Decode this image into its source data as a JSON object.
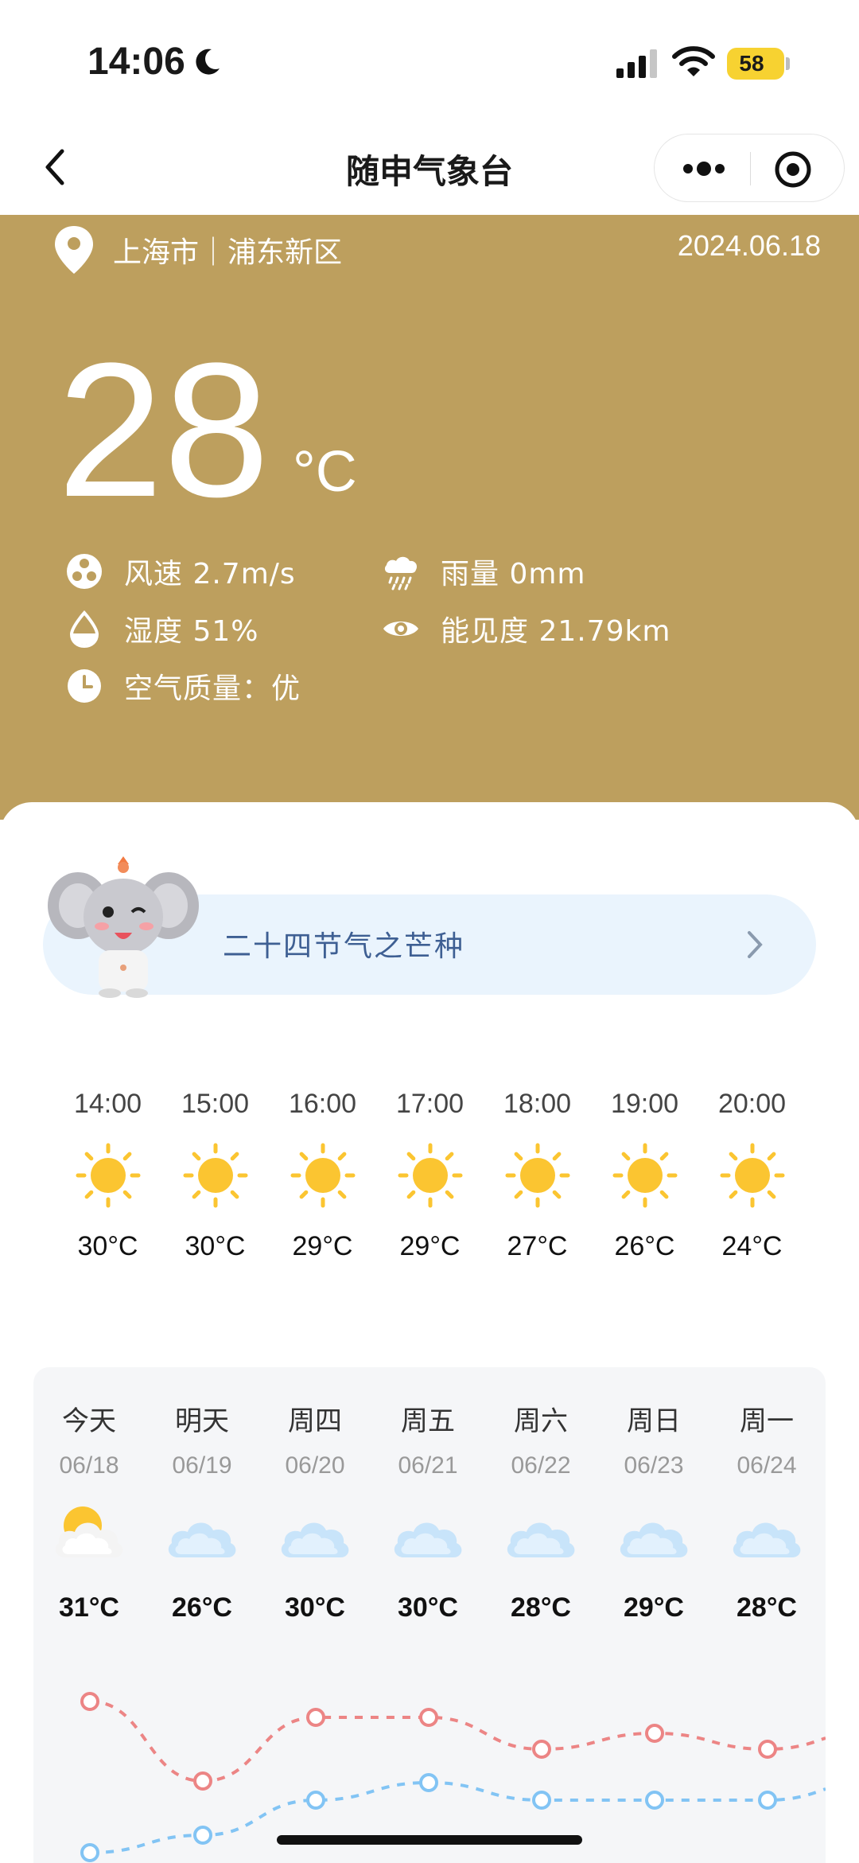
{
  "status_bar": {
    "time": "14:06",
    "battery": "58"
  },
  "nav": {
    "title": "随申气象台"
  },
  "hero": {
    "location": "上海市｜浦东新区",
    "date": "2024.06.18",
    "temperature": "28",
    "unit": "°C",
    "metrics": {
      "wind": "风速 2.7m/s",
      "rain": "雨量 0mm",
      "humidity": "湿度 51%",
      "visibility": "能见度 21.79km",
      "air": "空气质量：优"
    }
  },
  "solar_term": {
    "label": "二十四节气之芒种"
  },
  "hourly": [
    {
      "time": "14:00",
      "icon": "sun-icon",
      "temp": "30°C"
    },
    {
      "time": "15:00",
      "icon": "sun-icon",
      "temp": "30°C"
    },
    {
      "time": "16:00",
      "icon": "sun-icon",
      "temp": "29°C"
    },
    {
      "time": "17:00",
      "icon": "sun-icon",
      "temp": "29°C"
    },
    {
      "time": "18:00",
      "icon": "sun-icon",
      "temp": "27°C"
    },
    {
      "time": "19:00",
      "icon": "sun-icon",
      "temp": "26°C"
    },
    {
      "time": "20:00",
      "icon": "sun-icon",
      "temp": "24°C"
    }
  ],
  "daily": [
    {
      "day": "今天",
      "date": "06/18",
      "icon": "partly-sunny-icon",
      "temp": "31°C"
    },
    {
      "day": "明天",
      "date": "06/19",
      "icon": "cloud-icon",
      "temp": "26°C"
    },
    {
      "day": "周四",
      "date": "06/20",
      "icon": "cloud-icon",
      "temp": "30°C"
    },
    {
      "day": "周五",
      "date": "06/21",
      "icon": "cloud-icon",
      "temp": "30°C"
    },
    {
      "day": "周六",
      "date": "06/22",
      "icon": "cloud-icon",
      "temp": "28°C"
    },
    {
      "day": "周日",
      "date": "06/23",
      "icon": "cloud-icon",
      "temp": "29°C"
    },
    {
      "day": "周一",
      "date": "06/24",
      "icon": "cloud-icon",
      "temp": "28°C"
    }
  ],
  "trend": {
    "high": [
      31,
      26,
      30,
      30,
      28,
      29,
      28
    ],
    "low": [
      22,
      23,
      25,
      26,
      25,
      25,
      25
    ]
  },
  "colors": {
    "hero_bg": "#bd9f5e",
    "high_line": "#ec8585",
    "low_line": "#82c4f4",
    "sun": "#fbc531"
  }
}
